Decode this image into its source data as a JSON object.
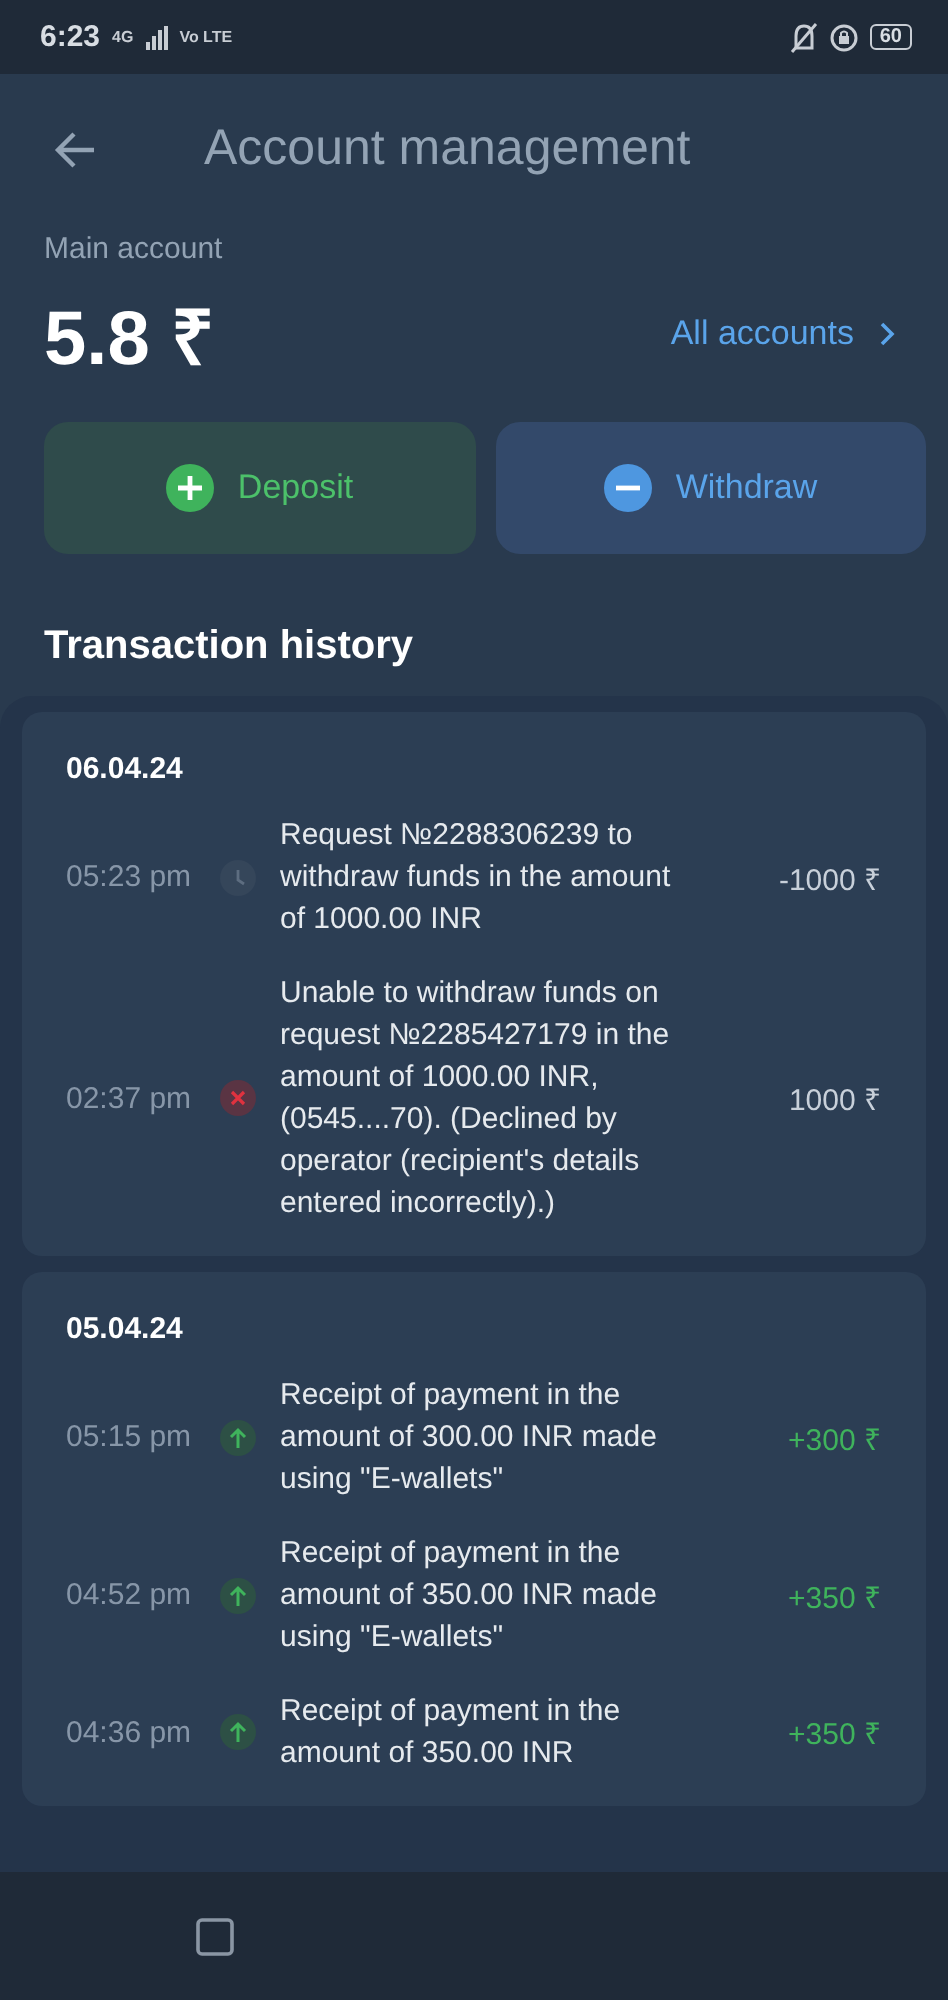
{
  "status_bar": {
    "time": "6:23",
    "network": "4G",
    "volte": "Vo LTE",
    "battery": "60"
  },
  "header": {
    "title": "Account management"
  },
  "balance": {
    "label": "Main account",
    "amount": "5.8 ₹",
    "link": "All accounts"
  },
  "actions": [
    {
      "kind": "deposit",
      "label": "Deposit"
    },
    {
      "kind": "withdraw",
      "label": "Withdraw"
    }
  ],
  "history": {
    "title": "Transaction history",
    "groups": [
      {
        "date": "06.04.24",
        "rows": [
          {
            "kind": "pending",
            "time": "05:23 pm",
            "text": "Request №2288306239 to withdraw funds in the amount of 1000.00 INR",
            "amount": "-1000 ₹"
          },
          {
            "kind": "declined",
            "time": "02:37 pm",
            "text": "Unable to withdraw funds on request №2285427179 in the amount of 1000.00 INR,  (0545....70). (Declined by operator (recipient's details entered incorrectly).)",
            "amount": "1000 ₹"
          }
        ]
      },
      {
        "date": "05.04.24",
        "rows": [
          {
            "kind": "deposit",
            "time": "05:15 pm",
            "text": "Receipt of payment in the amount of 300.00 INR made using \"E-wallets\"",
            "amount": "+300 ₹"
          },
          {
            "kind": "deposit",
            "time": "04:52 pm",
            "text": "Receipt of payment in the amount of 350.00 INR made using \"E-wallets\"",
            "amount": "+350 ₹"
          },
          {
            "kind": "deposit",
            "time": "04:36 pm",
            "text": "Receipt of payment in the amount of 350.00 INR",
            "amount": "+350 ₹"
          }
        ]
      }
    ]
  }
}
